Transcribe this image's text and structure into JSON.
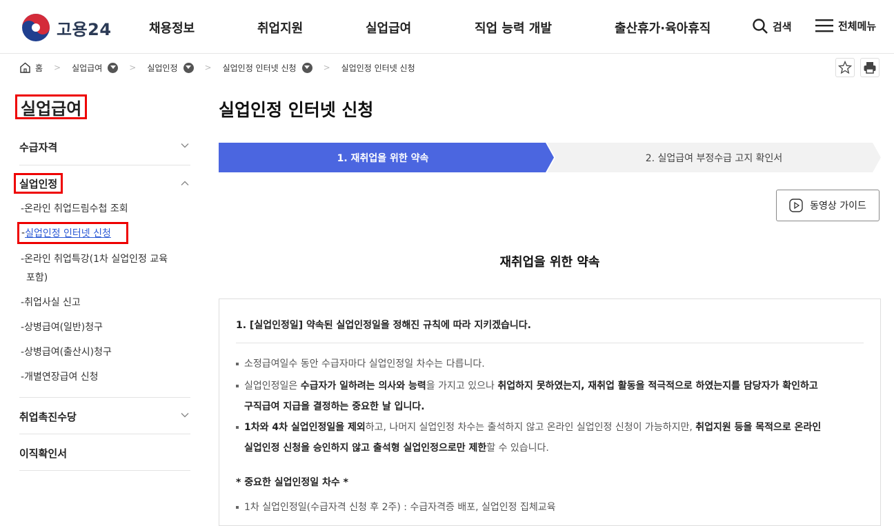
{
  "header": {
    "logo_text": "고용24",
    "nav": [
      "채용정보",
      "취업지원",
      "실업급여",
      "직업 능력 개발",
      "출산휴가·육아휴직"
    ],
    "search_label": "검색",
    "menu_label": "전체메뉴"
  },
  "breadcrumb": {
    "home": "홈",
    "items": [
      "실업급여",
      "실업인정",
      "실업인정 인터넷 신청",
      "실업인정 인터넷 신청"
    ]
  },
  "sidebar": {
    "title": "실업급여",
    "items": [
      {
        "label": "수급자격"
      },
      {
        "label": "실업인정"
      },
      {
        "label": "취업촉진수당"
      },
      {
        "label": "이직확인서"
      }
    ],
    "subitems": [
      "온라인 취업드림수첩 조회",
      "실업인정 인터넷 신청",
      "온라인 취업특강(1차 실업인정 교육",
      "포함)",
      "취업사실 신고",
      "상병급여(일반)청구",
      "상병급여(출산시)청구",
      "개별연장급여 신청"
    ]
  },
  "main": {
    "title": "실업인정 인터넷 신청",
    "steps": [
      "1. 재취업을 위한 약속",
      "2. 실업급여 부정수급 고지 확인서"
    ],
    "video_button": "동영상 가이드",
    "section_title": "재취업을 위한 약속",
    "box_title": "1. [실업인정일] 약속된 실업인정일을 정해진 규칙에 따라 지키겠습니다.",
    "bullets": {
      "b1": "소정급여일수 동안 수급자마다 실업인정일 차수는 다릅니다.",
      "b2_1": "실업인정일은 ",
      "b2_2": "수급자가 일하려는 의사와 능력",
      "b2_3": "을 가지고 있으나 ",
      "b2_4": "취업하지 못하였는지, 재취업 활동을 적극적으로 하였는지를 담당자가 확인하고",
      "b2_5": "구직급여 지급을 결정하는 중요한 날 입니다.",
      "b3_1": "1차와 4차 실업인정일을 제외",
      "b3_2": "하고, 나머지 실업인정 차수는 출석하지 않고 온라인 실업인정 신청이 가능하지만, ",
      "b3_3": "취업지원 등을 목적으로 온라인",
      "b3_4": "실업인정 신청을 승인하지 않고 출석형 실업인정으로만 제한",
      "b3_5": "할 수 있습니다.",
      "important": "* 중요한 실업인정일 차수 *",
      "b4": "1차 실업인정일(수급자격 신청 후 2주) : 수급자격증 배포, 실업인정 집체교육"
    }
  },
  "colors": {
    "step_active": "#4b66e0",
    "step_inactive": "#f2f2f2",
    "highlight_border": "#e00000",
    "link": "#2d5bd6"
  }
}
